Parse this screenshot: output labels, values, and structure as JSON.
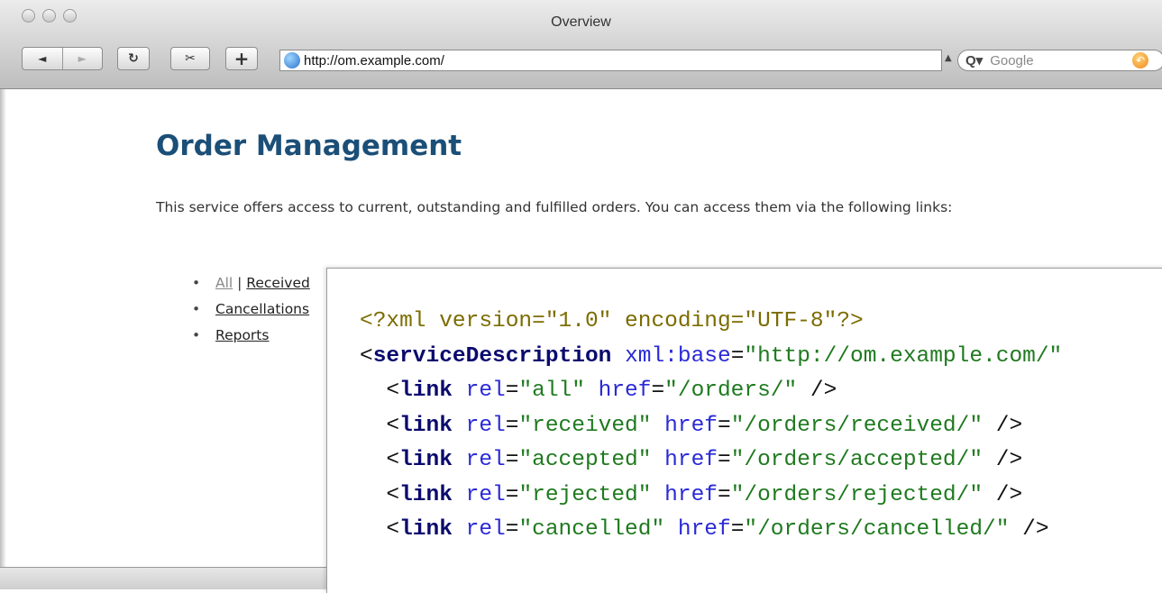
{
  "window": {
    "title": "Overview"
  },
  "toolbar": {
    "back": "◄",
    "forward": "►",
    "reload": "↻",
    "snip": "✂",
    "add": "+",
    "url": "http://om.example.com/",
    "search_placeholder": "Google",
    "search_q": "Q▾"
  },
  "page": {
    "heading": "Order Management",
    "intro": "This service offers access to current, outstanding and fulfilled orders. You can access them via the following links:",
    "links": {
      "row1_a": "All",
      "row1_sep": " | ",
      "row1_b": "Received",
      "row2": "Cancellations",
      "row3": "Reports"
    }
  },
  "xml": {
    "pi": "<?xml version=\"1.0\" encoding=\"UTF-8\"?>",
    "root_tag": "serviceDescription",
    "root_attr": "xml:base",
    "root_val": "\"http://om.example.com/\"",
    "lines": [
      {
        "tag": "link",
        "rel": "\"all\"",
        "href": "\"/orders/\"",
        "tail": " />"
      },
      {
        "tag": "link",
        "rel": "\"received\"",
        "href": "\"/orders/received/\"",
        "tail": " />"
      },
      {
        "tag": "link",
        "rel": "\"accepted\"",
        "href": "\"/orders/accepted/\"",
        "tail": " />"
      },
      {
        "tag": "link",
        "rel": "\"rejected\"",
        "href": "\"/orders/rejected/\"",
        "tail": " />"
      },
      {
        "tag": "link",
        "rel": "\"cancelled\"",
        "href": "\"/orders/cancelled/\"",
        "tail": " />"
      }
    ]
  }
}
